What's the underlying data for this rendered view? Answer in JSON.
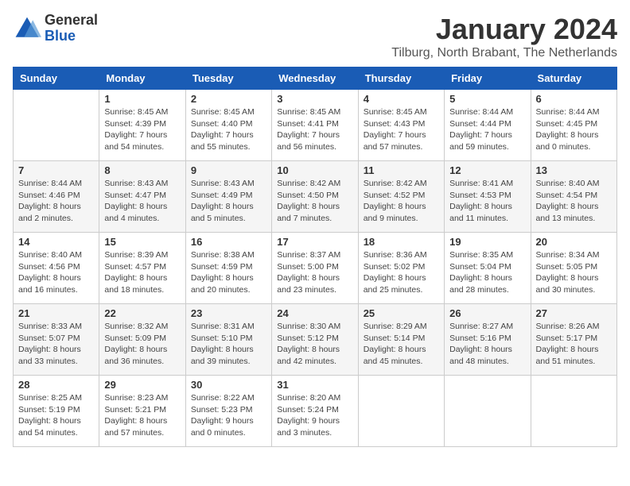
{
  "header": {
    "logo_general": "General",
    "logo_blue": "Blue",
    "month_title": "January 2024",
    "location": "Tilburg, North Brabant, The Netherlands"
  },
  "days_of_week": [
    "Sunday",
    "Monday",
    "Tuesday",
    "Wednesday",
    "Thursday",
    "Friday",
    "Saturday"
  ],
  "weeks": [
    [
      {
        "day": "",
        "sunrise": "",
        "sunset": "",
        "daylight": ""
      },
      {
        "day": "1",
        "sunrise": "Sunrise: 8:45 AM",
        "sunset": "Sunset: 4:39 PM",
        "daylight": "Daylight: 7 hours and 54 minutes."
      },
      {
        "day": "2",
        "sunrise": "Sunrise: 8:45 AM",
        "sunset": "Sunset: 4:40 PM",
        "daylight": "Daylight: 7 hours and 55 minutes."
      },
      {
        "day": "3",
        "sunrise": "Sunrise: 8:45 AM",
        "sunset": "Sunset: 4:41 PM",
        "daylight": "Daylight: 7 hours and 56 minutes."
      },
      {
        "day": "4",
        "sunrise": "Sunrise: 8:45 AM",
        "sunset": "Sunset: 4:43 PM",
        "daylight": "Daylight: 7 hours and 57 minutes."
      },
      {
        "day": "5",
        "sunrise": "Sunrise: 8:44 AM",
        "sunset": "Sunset: 4:44 PM",
        "daylight": "Daylight: 7 hours and 59 minutes."
      },
      {
        "day": "6",
        "sunrise": "Sunrise: 8:44 AM",
        "sunset": "Sunset: 4:45 PM",
        "daylight": "Daylight: 8 hours and 0 minutes."
      }
    ],
    [
      {
        "day": "7",
        "sunrise": "Sunrise: 8:44 AM",
        "sunset": "Sunset: 4:46 PM",
        "daylight": "Daylight: 8 hours and 2 minutes."
      },
      {
        "day": "8",
        "sunrise": "Sunrise: 8:43 AM",
        "sunset": "Sunset: 4:47 PM",
        "daylight": "Daylight: 8 hours and 4 minutes."
      },
      {
        "day": "9",
        "sunrise": "Sunrise: 8:43 AM",
        "sunset": "Sunset: 4:49 PM",
        "daylight": "Daylight: 8 hours and 5 minutes."
      },
      {
        "day": "10",
        "sunrise": "Sunrise: 8:42 AM",
        "sunset": "Sunset: 4:50 PM",
        "daylight": "Daylight: 8 hours and 7 minutes."
      },
      {
        "day": "11",
        "sunrise": "Sunrise: 8:42 AM",
        "sunset": "Sunset: 4:52 PM",
        "daylight": "Daylight: 8 hours and 9 minutes."
      },
      {
        "day": "12",
        "sunrise": "Sunrise: 8:41 AM",
        "sunset": "Sunset: 4:53 PM",
        "daylight": "Daylight: 8 hours and 11 minutes."
      },
      {
        "day": "13",
        "sunrise": "Sunrise: 8:40 AM",
        "sunset": "Sunset: 4:54 PM",
        "daylight": "Daylight: 8 hours and 13 minutes."
      }
    ],
    [
      {
        "day": "14",
        "sunrise": "Sunrise: 8:40 AM",
        "sunset": "Sunset: 4:56 PM",
        "daylight": "Daylight: 8 hours and 16 minutes."
      },
      {
        "day": "15",
        "sunrise": "Sunrise: 8:39 AM",
        "sunset": "Sunset: 4:57 PM",
        "daylight": "Daylight: 8 hours and 18 minutes."
      },
      {
        "day": "16",
        "sunrise": "Sunrise: 8:38 AM",
        "sunset": "Sunset: 4:59 PM",
        "daylight": "Daylight: 8 hours and 20 minutes."
      },
      {
        "day": "17",
        "sunrise": "Sunrise: 8:37 AM",
        "sunset": "Sunset: 5:00 PM",
        "daylight": "Daylight: 8 hours and 23 minutes."
      },
      {
        "day": "18",
        "sunrise": "Sunrise: 8:36 AM",
        "sunset": "Sunset: 5:02 PM",
        "daylight": "Daylight: 8 hours and 25 minutes."
      },
      {
        "day": "19",
        "sunrise": "Sunrise: 8:35 AM",
        "sunset": "Sunset: 5:04 PM",
        "daylight": "Daylight: 8 hours and 28 minutes."
      },
      {
        "day": "20",
        "sunrise": "Sunrise: 8:34 AM",
        "sunset": "Sunset: 5:05 PM",
        "daylight": "Daylight: 8 hours and 30 minutes."
      }
    ],
    [
      {
        "day": "21",
        "sunrise": "Sunrise: 8:33 AM",
        "sunset": "Sunset: 5:07 PM",
        "daylight": "Daylight: 8 hours and 33 minutes."
      },
      {
        "day": "22",
        "sunrise": "Sunrise: 8:32 AM",
        "sunset": "Sunset: 5:09 PM",
        "daylight": "Daylight: 8 hours and 36 minutes."
      },
      {
        "day": "23",
        "sunrise": "Sunrise: 8:31 AM",
        "sunset": "Sunset: 5:10 PM",
        "daylight": "Daylight: 8 hours and 39 minutes."
      },
      {
        "day": "24",
        "sunrise": "Sunrise: 8:30 AM",
        "sunset": "Sunset: 5:12 PM",
        "daylight": "Daylight: 8 hours and 42 minutes."
      },
      {
        "day": "25",
        "sunrise": "Sunrise: 8:29 AM",
        "sunset": "Sunset: 5:14 PM",
        "daylight": "Daylight: 8 hours and 45 minutes."
      },
      {
        "day": "26",
        "sunrise": "Sunrise: 8:27 AM",
        "sunset": "Sunset: 5:16 PM",
        "daylight": "Daylight: 8 hours and 48 minutes."
      },
      {
        "day": "27",
        "sunrise": "Sunrise: 8:26 AM",
        "sunset": "Sunset: 5:17 PM",
        "daylight": "Daylight: 8 hours and 51 minutes."
      }
    ],
    [
      {
        "day": "28",
        "sunrise": "Sunrise: 8:25 AM",
        "sunset": "Sunset: 5:19 PM",
        "daylight": "Daylight: 8 hours and 54 minutes."
      },
      {
        "day": "29",
        "sunrise": "Sunrise: 8:23 AM",
        "sunset": "Sunset: 5:21 PM",
        "daylight": "Daylight: 8 hours and 57 minutes."
      },
      {
        "day": "30",
        "sunrise": "Sunrise: 8:22 AM",
        "sunset": "Sunset: 5:23 PM",
        "daylight": "Daylight: 9 hours and 0 minutes."
      },
      {
        "day": "31",
        "sunrise": "Sunrise: 8:20 AM",
        "sunset": "Sunset: 5:24 PM",
        "daylight": "Daylight: 9 hours and 3 minutes."
      },
      {
        "day": "",
        "sunrise": "",
        "sunset": "",
        "daylight": ""
      },
      {
        "day": "",
        "sunrise": "",
        "sunset": "",
        "daylight": ""
      },
      {
        "day": "",
        "sunrise": "",
        "sunset": "",
        "daylight": ""
      }
    ]
  ]
}
